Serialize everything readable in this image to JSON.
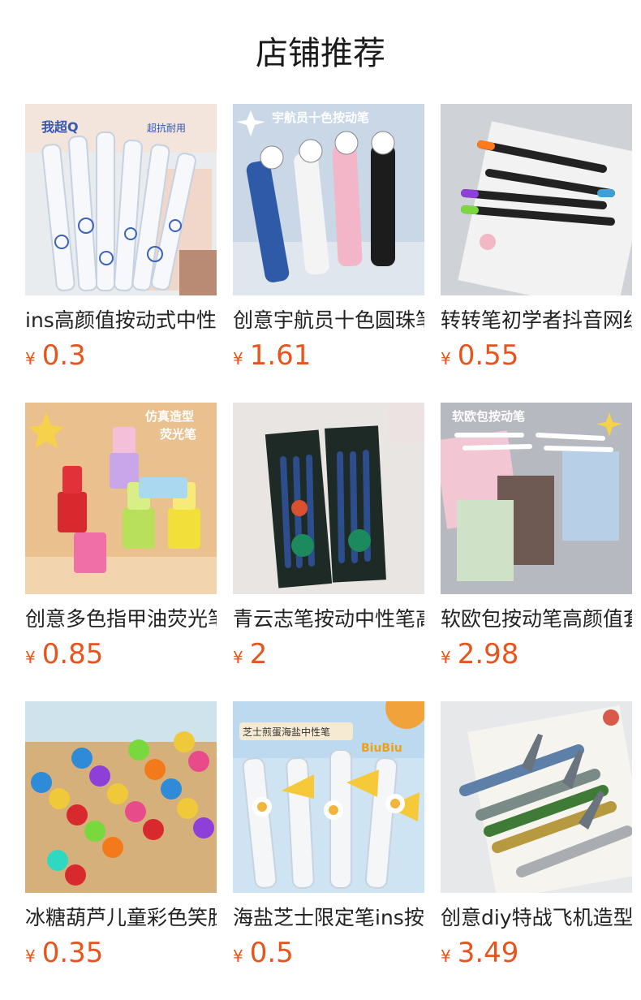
{
  "page": {
    "title": "店铺推荐"
  },
  "colors": {
    "price": "#e8541c",
    "text": "#222222"
  },
  "products": [
    {
      "name": "ins高颜值按动式中性笔",
      "currency": "¥",
      "price": "0.3",
      "image_icon": "clear-pens-image",
      "overlay": [
        "我超Q",
        "超抗耐用"
      ]
    },
    {
      "name": "创意宇航员十色圆珠笔",
      "currency": "¥",
      "price": "1.61",
      "image_icon": "astronaut-pens-image",
      "overlay": [
        "宇航员十色按动笔"
      ]
    },
    {
      "name": "转转笔初学者抖音网红",
      "currency": "¥",
      "price": "0.55",
      "image_icon": "spinning-pens-image",
      "overlay": []
    },
    {
      "name": "创意多色指甲油荧光笔",
      "currency": "¥",
      "price": "0.85",
      "image_icon": "nail-polish-highlighters-image",
      "overlay": [
        "仿真造型",
        "荧光笔"
      ]
    },
    {
      "name": "青云志笔按动中性笔高颜值",
      "currency": "¥",
      "price": "2",
      "image_icon": "dark-pen-sets-image",
      "overlay": []
    },
    {
      "name": "软欧包按动笔高颜值套装",
      "currency": "¥",
      "price": "2.98",
      "image_icon": "soft-bread-pens-image",
      "overlay": [
        "软欧包按动笔"
      ]
    },
    {
      "name": "冰糖葫芦儿童彩色笑脸蜡笔",
      "currency": "¥",
      "price": "0.35",
      "image_icon": "smiley-crayons-image",
      "overlay": []
    },
    {
      "name": "海盐芝士限定笔ins按动笔",
      "currency": "¥",
      "price": "0.5",
      "image_icon": "sea-salt-cheese-pens-image",
      "overlay": [
        "芝士煎蛋海盐中性笔",
        "BiuBiu"
      ]
    },
    {
      "name": "创意diy特战飞机造型笔",
      "currency": "¥",
      "price": "3.49",
      "image_icon": "fighter-jet-pens-image",
      "overlay": []
    }
  ]
}
